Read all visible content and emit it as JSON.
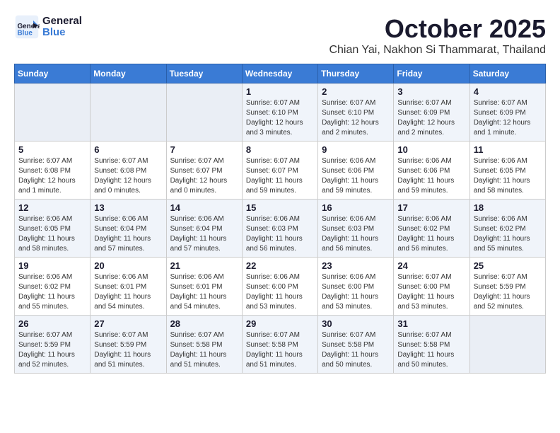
{
  "logo": {
    "line1": "General",
    "line2": "Blue"
  },
  "title": "October 2025",
  "location": "Chian Yai, Nakhon Si Thammarat, Thailand",
  "days_of_week": [
    "Sunday",
    "Monday",
    "Tuesday",
    "Wednesday",
    "Thursday",
    "Friday",
    "Saturday"
  ],
  "weeks": [
    [
      {
        "day": "",
        "info": ""
      },
      {
        "day": "",
        "info": ""
      },
      {
        "day": "",
        "info": ""
      },
      {
        "day": "1",
        "info": "Sunrise: 6:07 AM\nSunset: 6:10 PM\nDaylight: 12 hours and 3 minutes."
      },
      {
        "day": "2",
        "info": "Sunrise: 6:07 AM\nSunset: 6:10 PM\nDaylight: 12 hours and 2 minutes."
      },
      {
        "day": "3",
        "info": "Sunrise: 6:07 AM\nSunset: 6:09 PM\nDaylight: 12 hours and 2 minutes."
      },
      {
        "day": "4",
        "info": "Sunrise: 6:07 AM\nSunset: 6:09 PM\nDaylight: 12 hours and 1 minute."
      }
    ],
    [
      {
        "day": "5",
        "info": "Sunrise: 6:07 AM\nSunset: 6:08 PM\nDaylight: 12 hours and 1 minute."
      },
      {
        "day": "6",
        "info": "Sunrise: 6:07 AM\nSunset: 6:08 PM\nDaylight: 12 hours and 0 minutes."
      },
      {
        "day": "7",
        "info": "Sunrise: 6:07 AM\nSunset: 6:07 PM\nDaylight: 12 hours and 0 minutes."
      },
      {
        "day": "8",
        "info": "Sunrise: 6:07 AM\nSunset: 6:07 PM\nDaylight: 11 hours and 59 minutes."
      },
      {
        "day": "9",
        "info": "Sunrise: 6:06 AM\nSunset: 6:06 PM\nDaylight: 11 hours and 59 minutes."
      },
      {
        "day": "10",
        "info": "Sunrise: 6:06 AM\nSunset: 6:06 PM\nDaylight: 11 hours and 59 minutes."
      },
      {
        "day": "11",
        "info": "Sunrise: 6:06 AM\nSunset: 6:05 PM\nDaylight: 11 hours and 58 minutes."
      }
    ],
    [
      {
        "day": "12",
        "info": "Sunrise: 6:06 AM\nSunset: 6:05 PM\nDaylight: 11 hours and 58 minutes."
      },
      {
        "day": "13",
        "info": "Sunrise: 6:06 AM\nSunset: 6:04 PM\nDaylight: 11 hours and 57 minutes."
      },
      {
        "day": "14",
        "info": "Sunrise: 6:06 AM\nSunset: 6:04 PM\nDaylight: 11 hours and 57 minutes."
      },
      {
        "day": "15",
        "info": "Sunrise: 6:06 AM\nSunset: 6:03 PM\nDaylight: 11 hours and 56 minutes."
      },
      {
        "day": "16",
        "info": "Sunrise: 6:06 AM\nSunset: 6:03 PM\nDaylight: 11 hours and 56 minutes."
      },
      {
        "day": "17",
        "info": "Sunrise: 6:06 AM\nSunset: 6:02 PM\nDaylight: 11 hours and 56 minutes."
      },
      {
        "day": "18",
        "info": "Sunrise: 6:06 AM\nSunset: 6:02 PM\nDaylight: 11 hours and 55 minutes."
      }
    ],
    [
      {
        "day": "19",
        "info": "Sunrise: 6:06 AM\nSunset: 6:02 PM\nDaylight: 11 hours and 55 minutes."
      },
      {
        "day": "20",
        "info": "Sunrise: 6:06 AM\nSunset: 6:01 PM\nDaylight: 11 hours and 54 minutes."
      },
      {
        "day": "21",
        "info": "Sunrise: 6:06 AM\nSunset: 6:01 PM\nDaylight: 11 hours and 54 minutes."
      },
      {
        "day": "22",
        "info": "Sunrise: 6:06 AM\nSunset: 6:00 PM\nDaylight: 11 hours and 53 minutes."
      },
      {
        "day": "23",
        "info": "Sunrise: 6:06 AM\nSunset: 6:00 PM\nDaylight: 11 hours and 53 minutes."
      },
      {
        "day": "24",
        "info": "Sunrise: 6:07 AM\nSunset: 6:00 PM\nDaylight: 11 hours and 53 minutes."
      },
      {
        "day": "25",
        "info": "Sunrise: 6:07 AM\nSunset: 5:59 PM\nDaylight: 11 hours and 52 minutes."
      }
    ],
    [
      {
        "day": "26",
        "info": "Sunrise: 6:07 AM\nSunset: 5:59 PM\nDaylight: 11 hours and 52 minutes."
      },
      {
        "day": "27",
        "info": "Sunrise: 6:07 AM\nSunset: 5:59 PM\nDaylight: 11 hours and 51 minutes."
      },
      {
        "day": "28",
        "info": "Sunrise: 6:07 AM\nSunset: 5:58 PM\nDaylight: 11 hours and 51 minutes."
      },
      {
        "day": "29",
        "info": "Sunrise: 6:07 AM\nSunset: 5:58 PM\nDaylight: 11 hours and 51 minutes."
      },
      {
        "day": "30",
        "info": "Sunrise: 6:07 AM\nSunset: 5:58 PM\nDaylight: 11 hours and 50 minutes."
      },
      {
        "day": "31",
        "info": "Sunrise: 6:07 AM\nSunset: 5:58 PM\nDaylight: 11 hours and 50 minutes."
      },
      {
        "day": "",
        "info": ""
      }
    ]
  ]
}
